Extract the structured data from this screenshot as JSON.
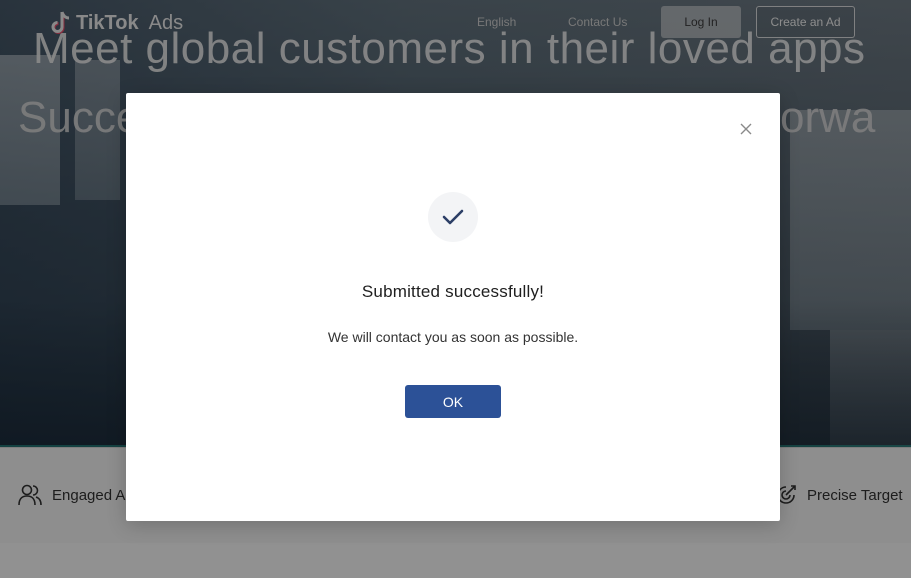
{
  "header": {
    "logo_brand": "TikTok",
    "logo_product": "Ads",
    "nav_language": "English",
    "nav_contact": "Contact Us",
    "login_label": "Log In",
    "create_ad_label": "Create an Ad"
  },
  "hero": {
    "headline": "Meet global customers in their loved apps",
    "subline_left": "Succe",
    "subline_right": "orwa"
  },
  "features": {
    "left_label": "Engaged A",
    "left_icon": "users-icon",
    "right_label": "Precise Target",
    "right_icon": "target-icon"
  },
  "modal": {
    "title": "Submitted successfully!",
    "message": "We will contact you as soon as possible.",
    "ok_label": "OK",
    "icon": "checkmark-icon",
    "close_icon": "close-icon"
  },
  "colors": {
    "primary_button": "#2c5197",
    "accent_line": "#2aa198",
    "modal_bg": "#ffffff"
  }
}
